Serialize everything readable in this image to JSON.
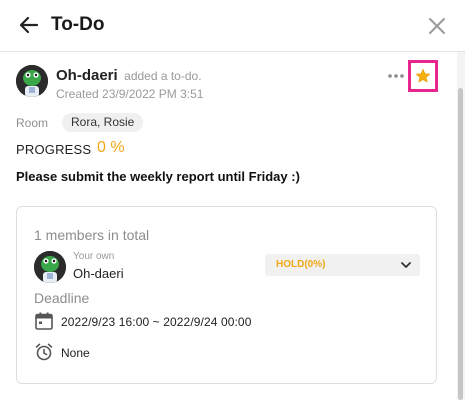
{
  "header": {
    "title": "To-Do",
    "back_icon": "arrow-left-icon",
    "close_icon": "close-icon"
  },
  "todo": {
    "author_name": "Oh-daeri",
    "author_action": "added a to-do.",
    "created": "Created 23/9/2022 PM 3:51",
    "more_icon": "more-horizontal-icon",
    "favorite_icon": "star-icon",
    "room_label": "Room",
    "room_value": "Rora, Rosie",
    "progress_label": "PROGRESS",
    "progress_value": "0 %",
    "content": "Please submit the weekly report until Friday :)"
  },
  "card": {
    "member_count": "1 members in total",
    "your_own": "Your own",
    "member_name": "Oh-daeri",
    "status": "HOLD(0%)",
    "deadline_label": "Deadline",
    "deadline_range": "2022/9/23 16:00  ~ 2022/9/24 00:00",
    "alarm_text": "None",
    "calendar_icon": "calendar-icon",
    "alarm_icon": "alarm-clock-icon"
  },
  "colors": {
    "accent": "#f0a818",
    "highlight_border": "#e8268e",
    "muted_text": "#8d8d8d"
  }
}
